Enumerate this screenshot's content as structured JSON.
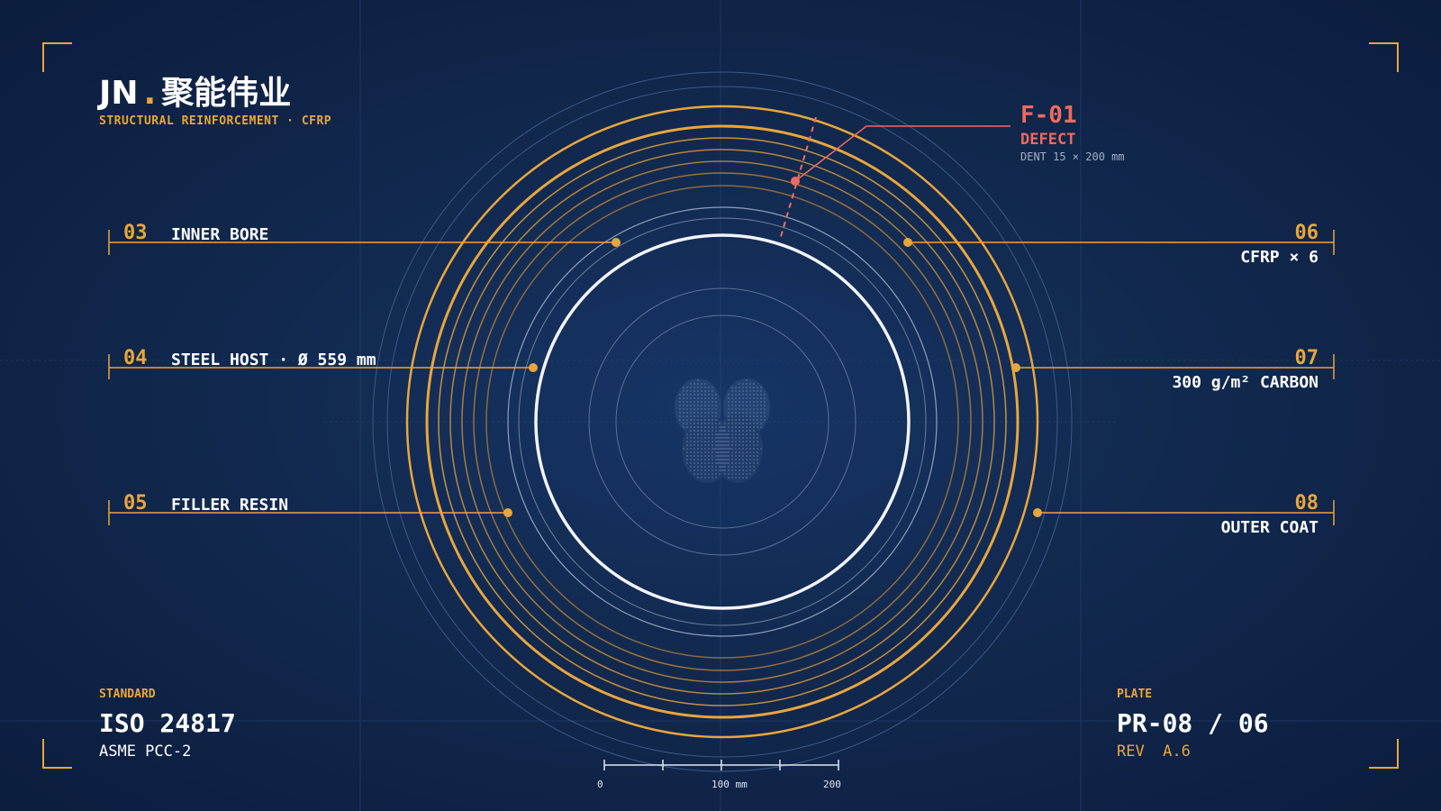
{
  "brand": {
    "code": "JN",
    "dot": ".",
    "name": "聚能伟业"
  },
  "subtitle": "STRUCTURAL REINFORCEMENT · CFRP",
  "labels_left": [
    {
      "num": "03",
      "text": "INNER BORE"
    },
    {
      "num": "04",
      "text": "STEEL HOST · Ø 559 mm"
    },
    {
      "num": "05",
      "text": "FILLER RESIN"
    }
  ],
  "labels_right": [
    {
      "num": "06",
      "text": "CFRP × 6"
    },
    {
      "num": "07",
      "text": "300 g/m² CARBON"
    },
    {
      "num": "08",
      "text": "OUTER COAT"
    }
  ],
  "defect": {
    "id": "F-01",
    "type": "DEFECT",
    "detail": "DENT 15 × 200 mm"
  },
  "standard": {
    "label": "STANDARD",
    "code": "ISO 24817",
    "alt": "ASME PCC-2"
  },
  "plate": {
    "label": "PLATE",
    "code": "PR-08 / 06",
    "rev": "REV  A.6"
  },
  "scale": {
    "start": "0",
    "mid": "100 mm",
    "end": "200"
  },
  "colors": {
    "background": "#12294f",
    "accent": "#e9a63d",
    "defect": "#ef6b5f",
    "steel": "#f2f4f8"
  }
}
